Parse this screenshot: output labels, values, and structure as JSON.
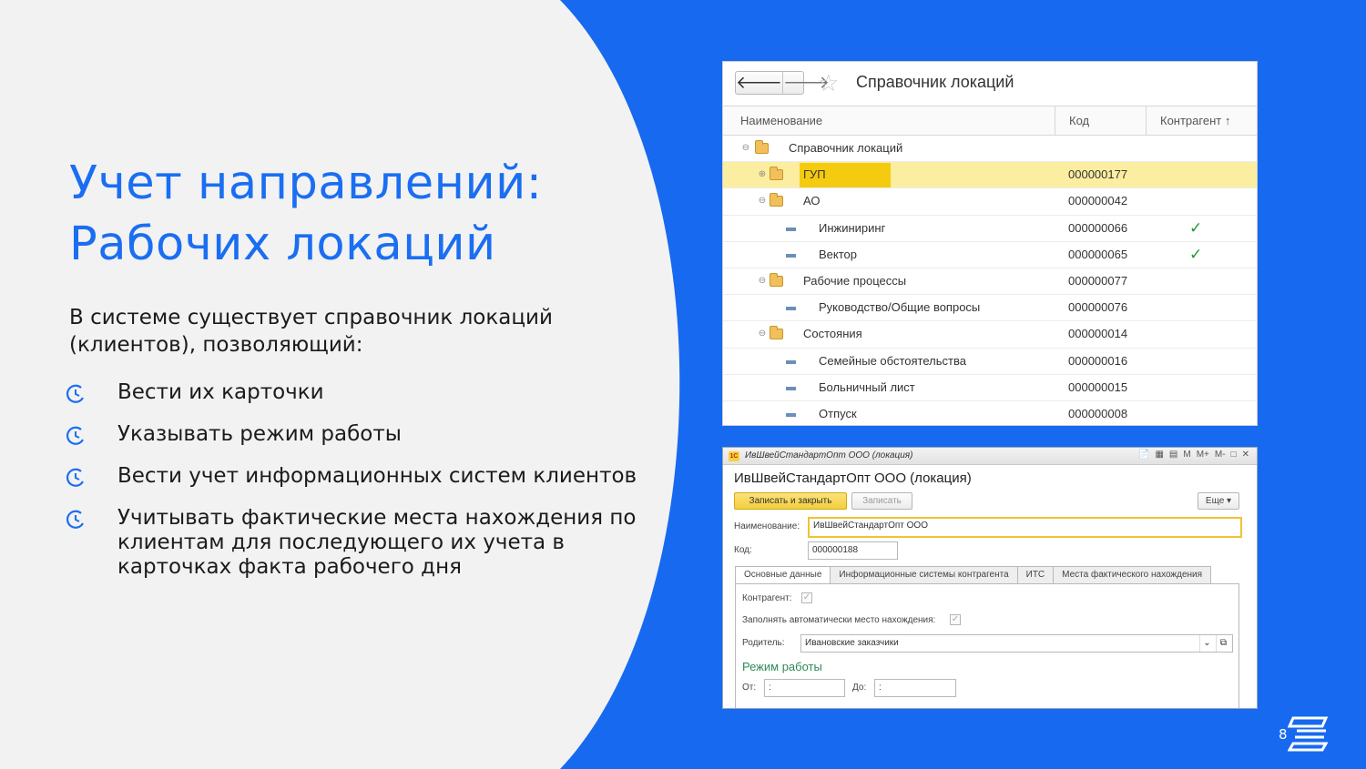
{
  "slide": {
    "title_line1": "Учет направлений:",
    "title_line2": "Рабочих локаций",
    "lead": "В системе существует справочник локаций (клиентов), позволяющий:",
    "bullets": [
      "Вести их карточки",
      "Указывать режим работы",
      "Вести учет информационных систем клиентов",
      "Учитывать фактические места нахождения по клиентам для последующего их учета в карточках факта рабочего дня"
    ],
    "page_number": "8",
    "colors": {
      "accent": "#1769f0",
      "title": "#1a6ef2",
      "panel": "#f2f2f2"
    }
  },
  "directory_window": {
    "back_icon": "arrow-left-icon",
    "forward_icon": "arrow-right-icon",
    "favorite_icon": "star-icon",
    "back_glyph": "🡐",
    "forward_glyph": "🡒",
    "title": "Справочник локаций",
    "columns": {
      "name": "Наименование",
      "code": "Код",
      "counterparty": "Контрагент ↑"
    },
    "rows": [
      {
        "name": "Справочник локаций",
        "code": "",
        "check": ""
      },
      {
        "name": "ГУП",
        "code": "000000177",
        "check": ""
      },
      {
        "name": "АО",
        "code": "000000042",
        "check": ""
      },
      {
        "name": "Инжиниринг",
        "code": "000000066",
        "check": "✓"
      },
      {
        "name": "Вектор",
        "code": "000000065",
        "check": "✓"
      },
      {
        "name": "Рабочие процессы",
        "code": "000000077",
        "check": ""
      },
      {
        "name": "Руководство/Общие вопросы",
        "code": "000000076",
        "check": ""
      },
      {
        "name": "Состояния",
        "code": "000000014",
        "check": ""
      },
      {
        "name": "Семейные обстоятельства",
        "code": "000000016",
        "check": ""
      },
      {
        "name": "Больничный лист",
        "code": "000000015",
        "check": ""
      },
      {
        "name": "Отпуск",
        "code": "000000008",
        "check": ""
      }
    ],
    "colors": {
      "selected_row": "#fbeea0",
      "selected_cell": "#f5cb10",
      "check": "#1e9a2f"
    }
  },
  "location_form": {
    "titlebar": "ИвШвейСтандартОпт ООО (локация)",
    "heading": "ИвШвейСтандартОпт ООО (локация)",
    "app_logo": "1С",
    "titlebar_icons": [
      "📄",
      "▦",
      "▤",
      "M",
      "M+",
      "M-",
      "□",
      "✕"
    ],
    "buttons": {
      "save_close": "Записать и закрыть",
      "save": "Записать",
      "more": "Еще ▾"
    },
    "fields": {
      "name_label": "Наименование:",
      "name_value": "ИвШвейСтандартОпт ООО",
      "code_label": "Код:",
      "code_value": "000000188"
    },
    "tabs": [
      "Основные данные",
      "Информационные системы контрагента",
      "ИТС",
      "Места фактического нахождения"
    ],
    "panel": {
      "counterparty_label": "Контрагент:",
      "counterparty_checked": true,
      "autofill_label": "Заполнять автоматически место нахождения:",
      "autofill_checked": true,
      "parent_label": "Родитель:",
      "parent_value": "Ивановские заказчики",
      "parent_dropdown": "⌄",
      "parent_open": "⧉",
      "section_title": "Режим работы",
      "from_label": "От:",
      "from_value": ":",
      "to_label": "До:",
      "to_value": ":"
    }
  }
}
